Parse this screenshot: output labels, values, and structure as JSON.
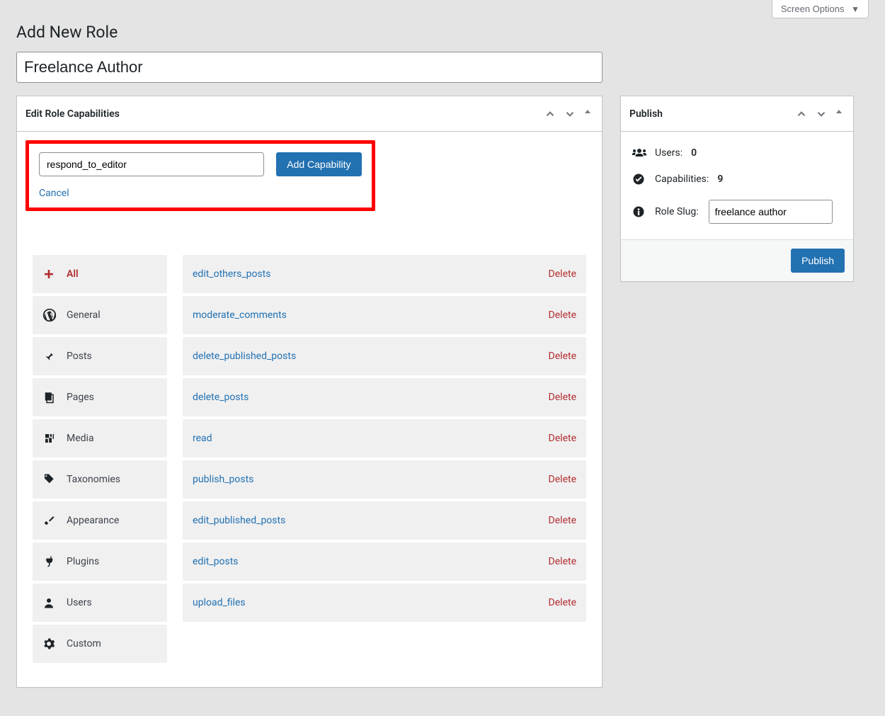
{
  "screen_options": "Screen Options",
  "page_title": "Add New Role",
  "role_name": "Freelance Author",
  "edit_caps_title": "Edit Role Capabilities",
  "add_cap_input": "respond_to_editor",
  "add_cap_button": "Add Capability",
  "cancel_label": "Cancel",
  "categories": [
    {
      "label": "All",
      "icon": "plus"
    },
    {
      "label": "General",
      "icon": "wp"
    },
    {
      "label": "Posts",
      "icon": "pin"
    },
    {
      "label": "Pages",
      "icon": "pages"
    },
    {
      "label": "Media",
      "icon": "media"
    },
    {
      "label": "Taxonomies",
      "icon": "tag"
    },
    {
      "label": "Appearance",
      "icon": "brush"
    },
    {
      "label": "Plugins",
      "icon": "plug"
    },
    {
      "label": "Users",
      "icon": "user"
    },
    {
      "label": "Custom",
      "icon": "gear"
    }
  ],
  "capabilities": [
    {
      "name": "edit_others_posts"
    },
    {
      "name": "moderate_comments"
    },
    {
      "name": "delete_published_posts"
    },
    {
      "name": "delete_posts"
    },
    {
      "name": "read"
    },
    {
      "name": "publish_posts"
    },
    {
      "name": "edit_published_posts"
    },
    {
      "name": "edit_posts"
    },
    {
      "name": "upload_files"
    }
  ],
  "delete_label": "Delete",
  "publish_box_title": "Publish",
  "users_label": "Users:",
  "users_count": "0",
  "caps_label": "Capabilities:",
  "caps_count": "9",
  "role_slug_label": "Role Slug:",
  "role_slug_value": "freelance author",
  "publish_button": "Publish"
}
